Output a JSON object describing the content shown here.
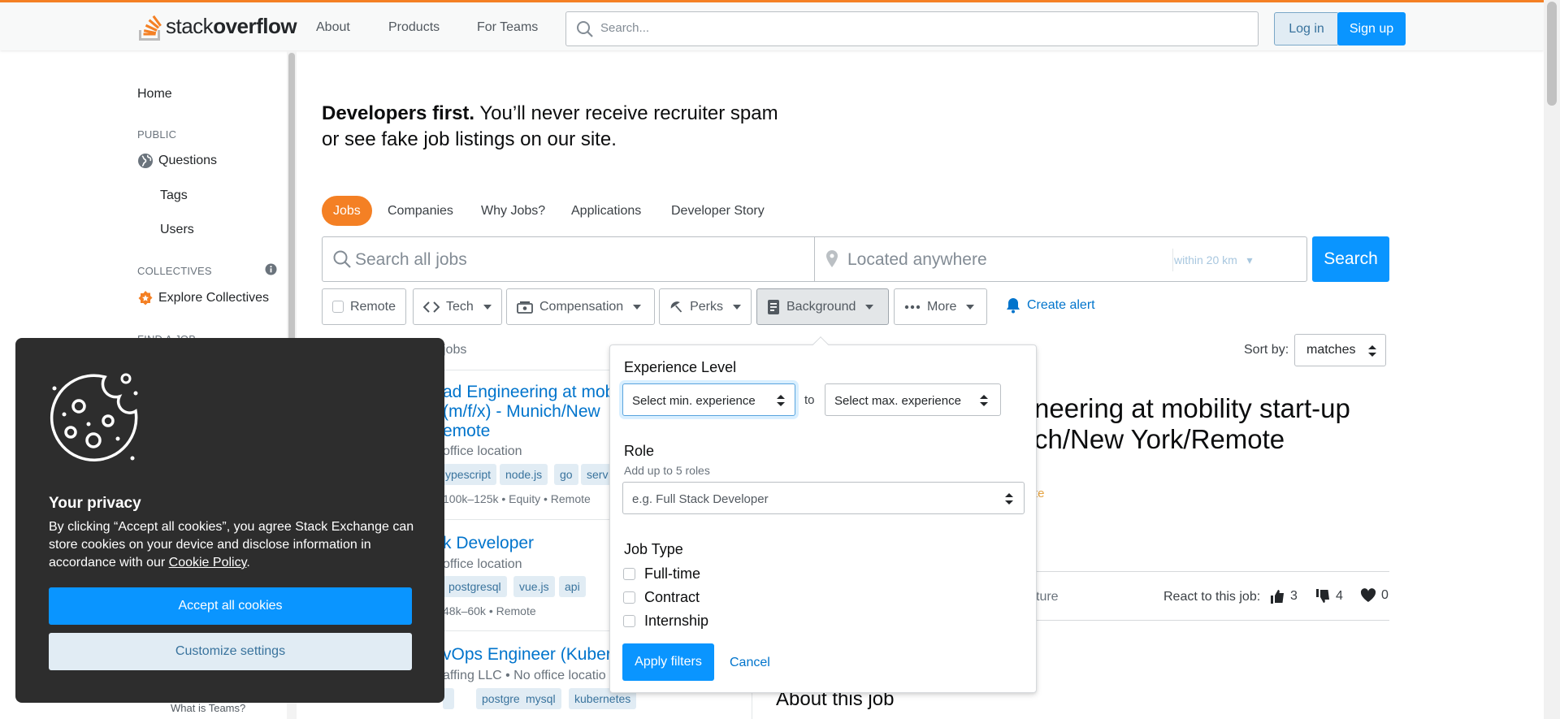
{
  "header": {
    "logo_text_plain": "stack",
    "logo_text_bold": "overflow",
    "nav": [
      "About",
      "Products",
      "For Teams"
    ],
    "search_placeholder": "Search...",
    "login": "Log in",
    "signup": "Sign up"
  },
  "sidebar": {
    "home": "Home",
    "public_label": "PUBLIC",
    "questions": "Questions",
    "tags": "Tags",
    "users": "Users",
    "collectives_label": "COLLECTIVES",
    "explore_collectives": "Explore Collectives",
    "find_a_job_label": "FIND A JOB",
    "what_is_teams": "What is Teams?"
  },
  "main": {
    "headline_bold": "Developers first.",
    "headline_rest_1": " You’ll never receive recruiter spam",
    "headline_rest_2": "or see fake job listings on our site.",
    "tabs": [
      "Jobs",
      "Companies",
      "Why Jobs?",
      "Applications",
      "Developer Story"
    ],
    "search_jobs_placeholder": "Search all jobs",
    "location_placeholder": "Located anywhere",
    "within": "within 20 km",
    "search_button": "Search",
    "filters": {
      "remote": "Remote",
      "tech": "Tech",
      "compensation": "Compensation",
      "perks": "Perks",
      "background": "Background",
      "more": "More"
    },
    "create_alert": "Create alert",
    "jobs_count": "jobs",
    "sort_label": "Sort by:",
    "sort_value": "matches"
  },
  "jobs": [
    {
      "title_lines": [
        "ad Engineering at mob",
        " (m/f/x) - Munich/New",
        "emote"
      ],
      "meta": "office location",
      "tags": [
        "ypescript",
        "node.js",
        "go",
        "serv"
      ],
      "salary": "100k–125k • Equity • Remote"
    },
    {
      "title_lines": [
        "k Developer"
      ],
      "meta": " office location",
      "tags": [
        "postgresql",
        "vue.js",
        "api"
      ],
      "salary": "48k–60k • Remote"
    },
    {
      "title_lines": [
        "vOps Engineer (Kuber"
      ],
      "meta": "affing LLC • No office locatio",
      "tags": [
        "postgresql",
        "mysql",
        "kubernetes"
      ],
      "salary": ""
    }
  ],
  "detail": {
    "title_line_1": "neering at mobility start-up",
    "title_line_2": "ch/New York/Remote",
    "orange_text": "te",
    "feature_text": "ture",
    "react_label": "React to this job:",
    "thumbs_up": "3",
    "thumbs_down": "4",
    "hearts": "0",
    "about": "About this job"
  },
  "popover": {
    "experience_label": "Experience Level",
    "min_exp": "Select min. experience",
    "to": "to",
    "max_exp": "Select max. experience",
    "role_label": "Role",
    "role_hint": "Add up to 5 roles",
    "role_placeholder": "e.g. Full Stack Developer",
    "job_type_label": "Job Type",
    "job_types": [
      "Full-time",
      "Contract",
      "Internship"
    ],
    "apply": "Apply filters",
    "cancel": "Cancel"
  },
  "cookie": {
    "title": "Your privacy",
    "body_1": "By clicking “Accept all cookies”, you agree Stack Exchange can store cookies on your device and disclose information in accordance with our ",
    "policy_link": "Cookie Policy",
    "body_end": ".",
    "accept": "Accept all cookies",
    "customize": "Customize settings"
  }
}
